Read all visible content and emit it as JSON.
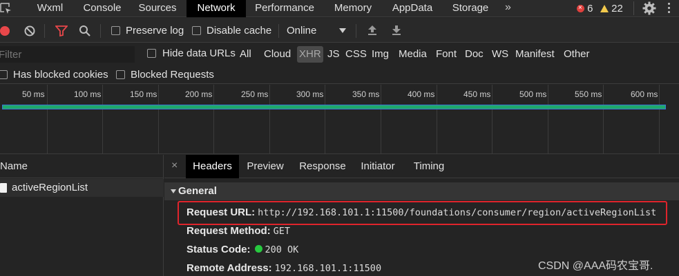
{
  "tabs": [
    {
      "label": "Wxml",
      "active": false
    },
    {
      "label": "Console",
      "active": false
    },
    {
      "label": "Sources",
      "active": false
    },
    {
      "label": "Network",
      "active": true
    },
    {
      "label": "Performance",
      "active": false
    },
    {
      "label": "Memory",
      "active": false
    },
    {
      "label": "AppData",
      "active": false
    },
    {
      "label": "Storage",
      "active": false
    }
  ],
  "more_tabs": "»",
  "errors_count": "6",
  "warnings_count": "22",
  "toolbar": {
    "preserve_log": "Preserve log",
    "disable_cache": "Disable cache",
    "throttling": "Online"
  },
  "filter": {
    "placeholder": "Filter",
    "hide_data_urls": "Hide data URLs",
    "types": [
      "All",
      "Cloud",
      "XHR",
      "JS",
      "CSS",
      "Img",
      "Media",
      "Font",
      "Doc",
      "WS",
      "Manifest",
      "Other"
    ],
    "active_type": "XHR"
  },
  "blocked": {
    "has_blocked_cookies": "Has blocked cookies",
    "blocked_requests": "Blocked Requests"
  },
  "timeline": {
    "ticks": [
      "50 ms",
      "100 ms",
      "150 ms",
      "200 ms",
      "250 ms",
      "300 ms",
      "350 ms",
      "400 ms",
      "450 ms",
      "500 ms",
      "550 ms",
      "600 ms"
    ]
  },
  "requests": {
    "header": "Name",
    "items": [
      "activeRegionList"
    ]
  },
  "detail": {
    "tabs": [
      "Headers",
      "Preview",
      "Response",
      "Initiator",
      "Timing"
    ],
    "active_tab": "Headers",
    "section": "General",
    "request_url_label": "Request URL:",
    "request_url": "http://192.168.101.1:11500/foundations/consumer/region/activeRegionList",
    "request_method_label": "Request Method:",
    "request_method": "GET",
    "status_code_label": "Status Code:",
    "status_code": "200 OK",
    "remote_address_label": "Remote Address:",
    "remote_address": "192.168.101.1:11500"
  },
  "watermark": "CSDN @AAA码农宝哥.",
  "colors": {
    "highlight_box": "#e0242c",
    "waterfall_bar": "#1fa86b",
    "status_ok": "#27c93f",
    "record": "#e8474a"
  }
}
